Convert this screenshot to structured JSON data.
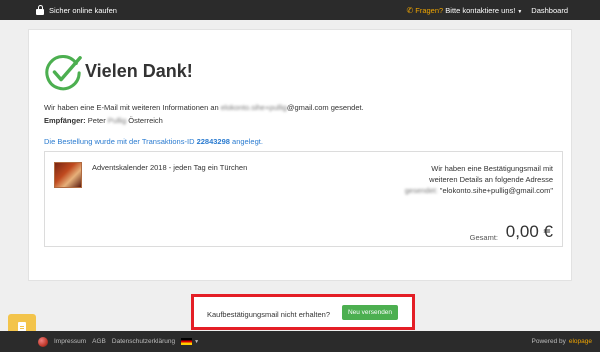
{
  "topbar": {
    "secure_label": "Sicher online kaufen",
    "questions_label": "Fragen?",
    "contact_label": "Bitte kontaktiere uns!",
    "dashboard_label": "Dashboard"
  },
  "thanks": {
    "title": "Vielen Dank!",
    "email_prefix": "Wir haben eine E-Mail mit weiteren Informationen an",
    "email_masked": "elokonto.sihe+pullig",
    "email_domain": "@gmail.com gesendet.",
    "recipient_label": "Empfänger:",
    "recipient_first": "Peter",
    "recipient_masked": "Pullig",
    "recipient_country": "Österreich",
    "transaction_prefix": "Die Bestellung wurde mit der Transaktions-ID",
    "transaction_id": "22843298",
    "transaction_suffix": "angelegt."
  },
  "order": {
    "product_name": "Adventskalender 2018 - jeden Tag ein Türchen",
    "mail_line1": "Wir haben eine Bestätigungsmail mit",
    "mail_line2": "weiteren Details an folgende Adresse",
    "mail_masked": "gesendet:",
    "mail_address": "\"elokonto.sihe+pullig@gmail.com\"",
    "total_label": "Gesamt:",
    "total_value": "0,00 €"
  },
  "resend": {
    "question": "Kaufbestätigungsmail nicht erhalten?",
    "button_label": "Neu versenden"
  },
  "footer": {
    "impressum": "Impressum",
    "agb": "AGB",
    "privacy": "Datenschutzerklärung",
    "powered_by": "Powered by",
    "brand": "elopage"
  },
  "colors": {
    "accent_green": "#4caf50",
    "highlight_red": "#e41e26",
    "link_blue": "#2a7bd0",
    "brand_orange": "#f0a500"
  }
}
